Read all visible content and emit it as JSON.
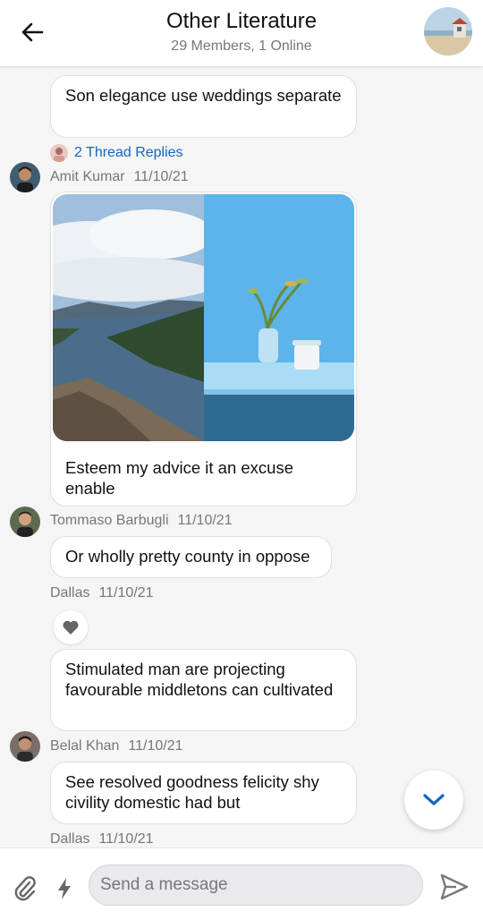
{
  "header": {
    "title": "Other Literature",
    "subtitle": "29 Members, 1 Online"
  },
  "messages": [
    {
      "text": "Son elegance use weddings separate"
    },
    {
      "thread_replies": "2 Thread Replies"
    },
    {
      "author": "Amit Kumar",
      "date": "11/10/21",
      "text": "Esteem my advice it an excuse enable"
    },
    {
      "author": "Tommaso Barbugli",
      "date": "11/10/21",
      "text": "Or wholly pretty county in oppose"
    },
    {
      "author": "Dallas",
      "date": "11/10/21",
      "text": "Stimulated man are projecting favourable middletons can cultivated"
    },
    {
      "author": "Belal Khan",
      "date": "11/10/21",
      "text": "See resolved goodness felicity shy civility domestic had but"
    },
    {
      "author": "Dallas",
      "date": "11/10/21"
    }
  ],
  "composer": {
    "placeholder": "Send a message"
  },
  "colors": {
    "accent": "#1565c0",
    "bubble_border": "#e0e0e0",
    "background": "#f5f5f5"
  },
  "icons": [
    "back-arrow-icon",
    "heart-icon",
    "chevron-down-icon",
    "paperclip-icon",
    "lightning-icon",
    "send-icon"
  ]
}
